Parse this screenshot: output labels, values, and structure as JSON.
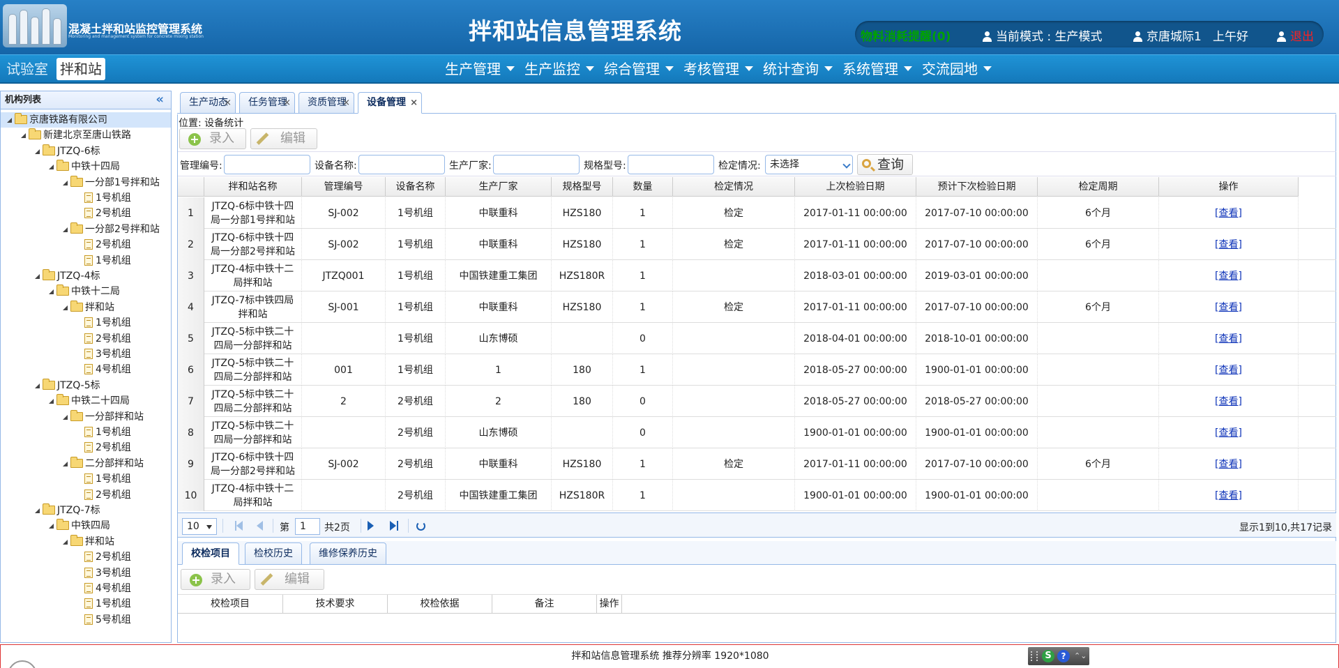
{
  "header": {
    "logo_title": "混凝土拌和站监控管理系统",
    "logo_subtitle": "Monitoring and management system for concrete mixing station",
    "system_title": "拌和站信息管理系统",
    "material_alert": "物料消耗提醒(0)",
    "mode_label": "当前模式 : 生产模式",
    "user_greeting": "京唐城际1   上午好",
    "logout": "退出",
    "colors": {
      "alert": "#00a300",
      "logout": "#ff2020",
      "header_bg": "#1c6fb3"
    }
  },
  "nav": {
    "modules": [
      "试验室",
      "拌和站"
    ],
    "active_module": "拌和站",
    "menu": [
      "生产管理",
      "生产监控",
      "综合管理",
      "考核管理",
      "统计查询",
      "系统管理",
      "交流园地"
    ]
  },
  "sidebar": {
    "title": "机构列表",
    "tree": [
      {
        "label": "京唐铁路有限公司",
        "level": 0,
        "type": "folder",
        "selected": true
      },
      {
        "label": "新建北京至唐山铁路",
        "level": 1,
        "type": "folder"
      },
      {
        "label": "JTZQ-6标",
        "level": 2,
        "type": "folder"
      },
      {
        "label": "中铁十四局",
        "level": 3,
        "type": "folder"
      },
      {
        "label": "一分部1号拌和站",
        "level": 4,
        "type": "folder"
      },
      {
        "label": "1号机组",
        "level": 5,
        "type": "file"
      },
      {
        "label": "2号机组",
        "level": 5,
        "type": "file"
      },
      {
        "label": "一分部2号拌和站",
        "level": 4,
        "type": "folder"
      },
      {
        "label": "2号机组",
        "level": 5,
        "type": "file"
      },
      {
        "label": "1号机组",
        "level": 5,
        "type": "file"
      },
      {
        "label": "JTZQ-4标",
        "level": 2,
        "type": "folder"
      },
      {
        "label": "中铁十二局",
        "level": 3,
        "type": "folder"
      },
      {
        "label": "拌和站",
        "level": 4,
        "type": "folder"
      },
      {
        "label": "1号机组",
        "level": 5,
        "type": "file"
      },
      {
        "label": "2号机组",
        "level": 5,
        "type": "file"
      },
      {
        "label": "3号机组",
        "level": 5,
        "type": "file"
      },
      {
        "label": "4号机组",
        "level": 5,
        "type": "file"
      },
      {
        "label": "JTZQ-5标",
        "level": 2,
        "type": "folder"
      },
      {
        "label": "中铁二十四局",
        "level": 3,
        "type": "folder"
      },
      {
        "label": "一分部拌和站",
        "level": 4,
        "type": "folder"
      },
      {
        "label": "1号机组",
        "level": 5,
        "type": "file"
      },
      {
        "label": "2号机组",
        "level": 5,
        "type": "file"
      },
      {
        "label": "二分部拌和站",
        "level": 4,
        "type": "folder"
      },
      {
        "label": "1号机组",
        "level": 5,
        "type": "file"
      },
      {
        "label": "2号机组",
        "level": 5,
        "type": "file"
      },
      {
        "label": "JTZQ-7标",
        "level": 2,
        "type": "folder"
      },
      {
        "label": "中铁四局",
        "level": 3,
        "type": "folder"
      },
      {
        "label": "拌和站",
        "level": 4,
        "type": "folder"
      },
      {
        "label": "2号机组",
        "level": 5,
        "type": "file"
      },
      {
        "label": "3号机组",
        "level": 5,
        "type": "file"
      },
      {
        "label": "4号机组",
        "level": 5,
        "type": "file"
      },
      {
        "label": "1号机组",
        "level": 5,
        "type": "file"
      },
      {
        "label": "5号机组",
        "level": 5,
        "type": "file"
      }
    ]
  },
  "tabs": [
    {
      "label": "生产动态",
      "close": "×"
    },
    {
      "label": "任务管理",
      "close": "×"
    },
    {
      "label": "资质管理",
      "close": "×"
    },
    {
      "label": "设备管理",
      "close": "×",
      "active": true
    }
  ],
  "location": "位置: 设备统计",
  "toolbar": {
    "add": "录入",
    "edit": "编辑"
  },
  "filters": {
    "code_label": "管理编号:",
    "name_label": "设备名称:",
    "maker_label": "生产厂家:",
    "model_label": "规格型号:",
    "status_label": "检定情况:",
    "status_value": "未选择",
    "search": "查询"
  },
  "table": {
    "headers": [
      "拌和站名称",
      "管理编号",
      "设备名称",
      "生产厂家",
      "规格型号",
      "数量",
      "检定情况",
      "上次检验日期",
      "预计下次检验日期",
      "检定周期",
      "操作"
    ],
    "rows": [
      [
        "1",
        "JTZQ-6标中铁十四局一分部1号拌和站",
        "SJ-002",
        "1号机组",
        "中联重科",
        "HZS180",
        "1",
        "检定",
        "2017-01-11 00:00:00",
        "2017-07-10 00:00:00",
        "6个月",
        "[查看]"
      ],
      [
        "2",
        "JTZQ-6标中铁十四局一分部2号拌和站",
        "SJ-002",
        "1号机组",
        "中联重科",
        "HZS180",
        "1",
        "检定",
        "2017-01-11 00:00:00",
        "2017-07-10 00:00:00",
        "6个月",
        "[查看]"
      ],
      [
        "3",
        "JTZQ-4标中铁十二局拌和站",
        "JTZQ001",
        "1号机组",
        "中国铁建重工集团",
        "HZS180R",
        "1",
        "",
        "2018-03-01 00:00:00",
        "2019-03-01 00:00:00",
        "",
        "[查看]"
      ],
      [
        "4",
        "JTZQ-7标中铁四局拌和站",
        "SJ-001",
        "1号机组",
        "中联重科",
        "HZS180",
        "1",
        "检定",
        "2017-01-11 00:00:00",
        "2017-07-10 00:00:00",
        "6个月",
        "[查看]"
      ],
      [
        "5",
        "JTZQ-5标中铁二十四局一分部拌和站",
        "",
        "1号机组",
        "山东博硕",
        "",
        "0",
        "",
        "2018-04-01 00:00:00",
        "2018-10-01 00:00:00",
        "",
        "[查看]"
      ],
      [
        "6",
        "JTZQ-5标中铁二十四局二分部拌和站",
        "001",
        "1号机组",
        "1",
        "180",
        "1",
        "",
        "2018-05-27 00:00:00",
        "1900-01-01 00:00:00",
        "",
        "[查看]"
      ],
      [
        "7",
        "JTZQ-5标中铁二十四局二分部拌和站",
        "2",
        "2号机组",
        "2",
        "180",
        "0",
        "",
        "2018-05-27 00:00:00",
        "2018-05-27 00:00:00",
        "",
        "[查看]"
      ],
      [
        "8",
        "JTZQ-5标中铁二十四局一分部拌和站",
        "",
        "2号机组",
        "山东博硕",
        "",
        "0",
        "",
        "1900-01-01 00:00:00",
        "1900-01-01 00:00:00",
        "",
        "[查看]"
      ],
      [
        "9",
        "JTZQ-6标中铁十四局一分部2号拌和站",
        "SJ-002",
        "2号机组",
        "中联重科",
        "HZS180",
        "1",
        "检定",
        "2017-01-11 00:00:00",
        "2017-07-10 00:00:00",
        "6个月",
        "[查看]"
      ],
      [
        "10",
        "JTZQ-4标中铁十二局拌和站",
        "",
        "2号机组",
        "中国铁建重工集团",
        "HZS180R",
        "1",
        "",
        "1900-01-01 00:00:00",
        "1900-01-01 00:00:00",
        "",
        "[查看]"
      ]
    ]
  },
  "pager": {
    "page_size": "10",
    "page_prefix": "第",
    "page": "1",
    "total_pages": "共2页",
    "summary": "显示1到10,共17记录"
  },
  "sub_tabs": [
    "校检项目",
    "检校历史",
    "维修保养历史"
  ],
  "sub_toolbar": {
    "add": "录入",
    "edit": "编辑"
  },
  "sub_table": {
    "headers": [
      "校检项目",
      "技术要求",
      "校检依据",
      "备注",
      "操作"
    ]
  },
  "footer": {
    "text": "拌和站信息管理系统 推荐分辨率 1920*1080",
    "tray_s": "S",
    "tray_q": "?",
    "tray_caret": "⌃⌄"
  }
}
